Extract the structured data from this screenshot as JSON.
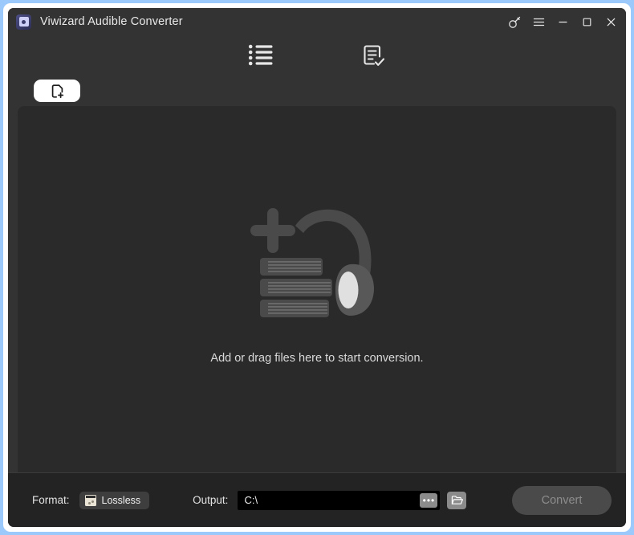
{
  "window": {
    "title": "Viwizard Audible Converter",
    "app_icon": "app-logo-icon",
    "controls": [
      {
        "name": "key-icon",
        "label": "Register"
      },
      {
        "name": "menu-icon",
        "label": "Menu"
      },
      {
        "name": "minimize-icon",
        "label": "Minimize"
      },
      {
        "name": "maximize-icon",
        "label": "Maximize"
      },
      {
        "name": "close-icon",
        "label": "Close"
      }
    ]
  },
  "toolbar": {
    "items": [
      {
        "name": "task-list-icon",
        "label": "Converting list"
      },
      {
        "name": "document-check-icon",
        "label": "Converted history"
      }
    ]
  },
  "addbar": {
    "add_files_label": "Add files",
    "add_files_icon": "file-plus-icon"
  },
  "content": {
    "illustration": "add-audiobook-headphone-illustration",
    "empty_text": "Add or drag files here to start conversion."
  },
  "bottombar": {
    "format_label": "Format:",
    "format_value": "Lossless",
    "format_icon": "audio-file-icon",
    "output_label": "Output:",
    "output_path": "C:\\",
    "output_placeholder": "C:\\",
    "browse_dots_label": "•••",
    "open_folder_icon": "folder-open-icon",
    "convert_label": "Convert"
  },
  "colors": {
    "selection_border": "#9cc9fb",
    "window_chrome": "#333333",
    "content_panel": "#2a2a2a",
    "bottom_bar": "#232323",
    "accent_button": "#ffffff",
    "convert_disabled": "#4a4a4a"
  }
}
